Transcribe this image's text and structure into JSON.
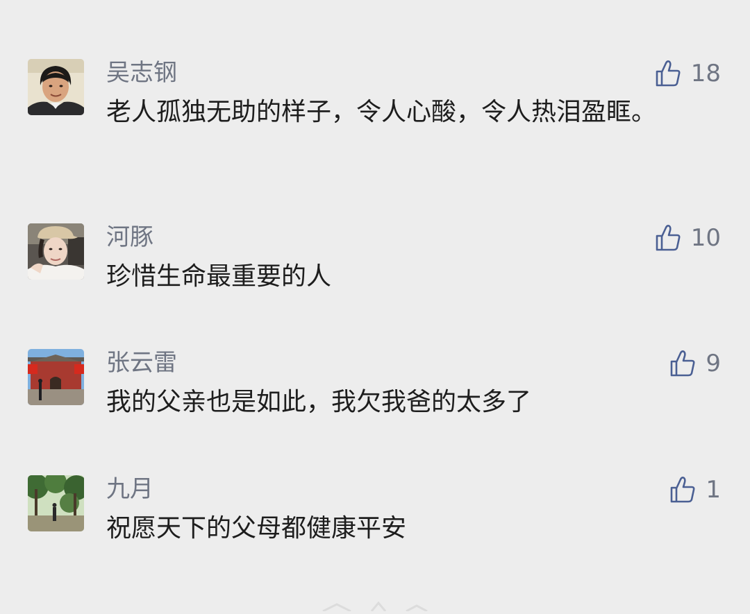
{
  "comments": [
    {
      "username": "吴志钢",
      "text": "老人孤独无助的样子，令人心酸，令人热泪盈眶。",
      "likes": "18",
      "avatar_icon": "man-portrait-avatar"
    },
    {
      "username": "河豚",
      "text": "珍惜生命最重要的人",
      "likes": "10",
      "avatar_icon": "woman-cap-avatar"
    },
    {
      "username": "张云雷",
      "text": "我的父亲也是如此，我欠我爸的太多了",
      "likes": "9",
      "avatar_icon": "tiananmen-avatar"
    },
    {
      "username": "九月",
      "text": "祝愿天下的父母都健康平安",
      "likes": "1",
      "avatar_icon": "forest-avatar"
    }
  ],
  "like_icon": "thumbs-up-icon",
  "colors": {
    "background": "#ededed",
    "username": "#6f7583",
    "comment_text": "#1d1d1d",
    "like_icon": "#4a5f93"
  }
}
